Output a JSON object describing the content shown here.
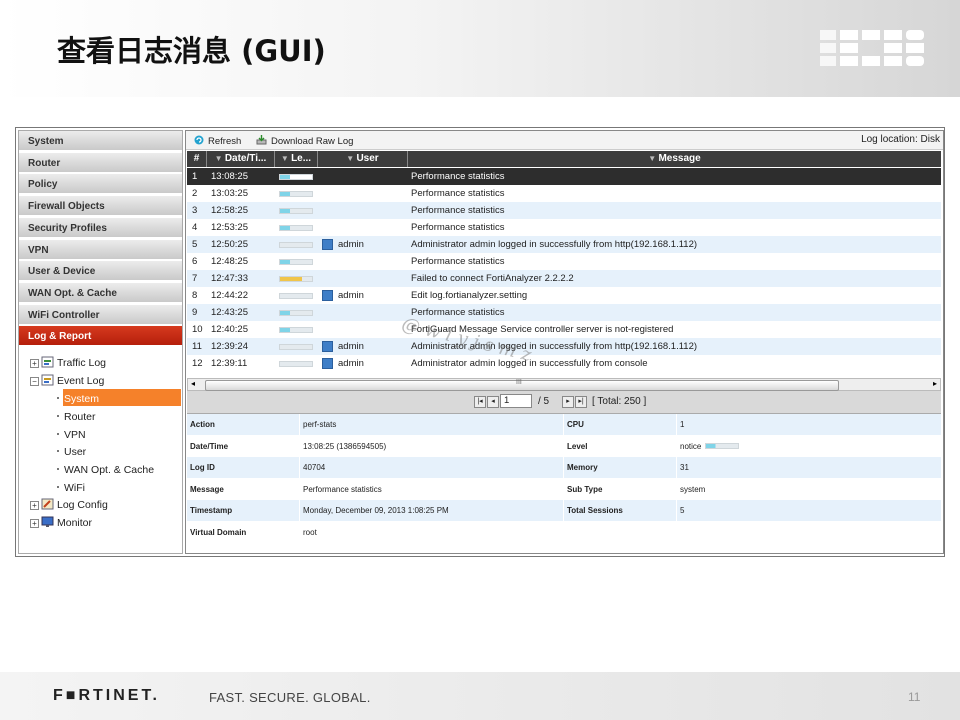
{
  "slide": {
    "title": "查看日志消息 (GUI)",
    "page_number": "11"
  },
  "footer": {
    "brand": "F■RTINET.",
    "tagline": "FAST. SECURE. GLOBAL."
  },
  "colors": {
    "accent": "#c8331a",
    "selection": "#f5812a",
    "row_alt": "#e6f1fb",
    "header_dark": "#3c3c3c"
  },
  "sidebar": {
    "items": [
      {
        "label": "System"
      },
      {
        "label": "Router"
      },
      {
        "label": "Policy"
      },
      {
        "label": "Firewall Objects"
      },
      {
        "label": "Security Profiles"
      },
      {
        "label": "VPN"
      },
      {
        "label": "User & Device"
      },
      {
        "label": "WAN Opt. & Cache"
      },
      {
        "label": "WiFi Controller"
      },
      {
        "label": "Log & Report"
      }
    ],
    "active_label": "Log & Report",
    "tree": {
      "traffic_log": "Traffic Log",
      "event_log": "Event Log",
      "event_children": [
        "System",
        "Router",
        "VPN",
        "User",
        "WAN Opt. & Cache",
        "WiFi"
      ],
      "selected": "System",
      "log_config": "Log Config",
      "monitor": "Monitor"
    }
  },
  "toolbar": {
    "refresh": "Refresh",
    "download": "Download Raw Log",
    "log_location": "Log location: Disk"
  },
  "table": {
    "headers": {
      "num": "#",
      "datetime": "Date/Ti...",
      "level": "Le...",
      "user": "User",
      "message": "Message"
    },
    "rows": [
      {
        "n": "1",
        "time": "13:08:25",
        "level": "notice",
        "user": "",
        "msg": "Performance statistics"
      },
      {
        "n": "2",
        "time": "13:03:25",
        "level": "notice",
        "user": "",
        "msg": "Performance statistics"
      },
      {
        "n": "3",
        "time": "12:58:25",
        "level": "notice",
        "user": "",
        "msg": "Performance statistics"
      },
      {
        "n": "4",
        "time": "12:53:25",
        "level": "notice",
        "user": "",
        "msg": "Performance statistics"
      },
      {
        "n": "5",
        "time": "12:50:25",
        "level": "information",
        "user": "admin",
        "msg": "Administrator admin logged in successfully from http(192.168.1.112)"
      },
      {
        "n": "6",
        "time": "12:48:25",
        "level": "notice",
        "user": "",
        "msg": "Performance statistics"
      },
      {
        "n": "7",
        "time": "12:47:33",
        "level": "warning",
        "user": "",
        "msg": "Failed to connect FortiAnalyzer 2.2.2.2"
      },
      {
        "n": "8",
        "time": "12:44:22",
        "level": "information",
        "user": "admin",
        "msg": "Edit log.fortianalyzer.setting"
      },
      {
        "n": "9",
        "time": "12:43:25",
        "level": "notice",
        "user": "",
        "msg": "Performance statistics"
      },
      {
        "n": "10",
        "time": "12:40:25",
        "level": "notice",
        "user": "",
        "msg": "FortiGuard Message Service controller server is not-registered"
      },
      {
        "n": "11",
        "time": "12:39:24",
        "level": "information",
        "user": "admin",
        "msg": "Administrator admin logged in successfully from http(192.168.1.112)"
      },
      {
        "n": "12",
        "time": "12:39:11",
        "level": "information",
        "user": "admin",
        "msg": "Administrator admin logged in successfully from console"
      }
    ],
    "selected_row": 1,
    "scroll_label": "III"
  },
  "pager": {
    "page": "1",
    "of": "/ 5",
    "total": "[ Total: 250 ]"
  },
  "details": {
    "rows": [
      {
        "l1": "Action",
        "v1": "perf-stats",
        "l2": "CPU",
        "v2": "1"
      },
      {
        "l1": "Date/Time",
        "v1": "13:08:25 (1386594505)",
        "l2": "Level",
        "v2": "notice"
      },
      {
        "l1": "Log ID",
        "v1": "40704",
        "l2": "Memory",
        "v2": "31"
      },
      {
        "l1": "Message",
        "v1": "Performance statistics",
        "l2": "Sub Type",
        "v2": "system"
      },
      {
        "l1": "Timestamp",
        "v1": "Monday, December 09, 2013 1:08:25 PM",
        "l2": "Total Sessions",
        "v2": "5"
      },
      {
        "l1": "Virtual Domain",
        "v1": "root",
        "l2": "",
        "v2": ""
      }
    ]
  },
  "watermark": "@wlyjsmz"
}
